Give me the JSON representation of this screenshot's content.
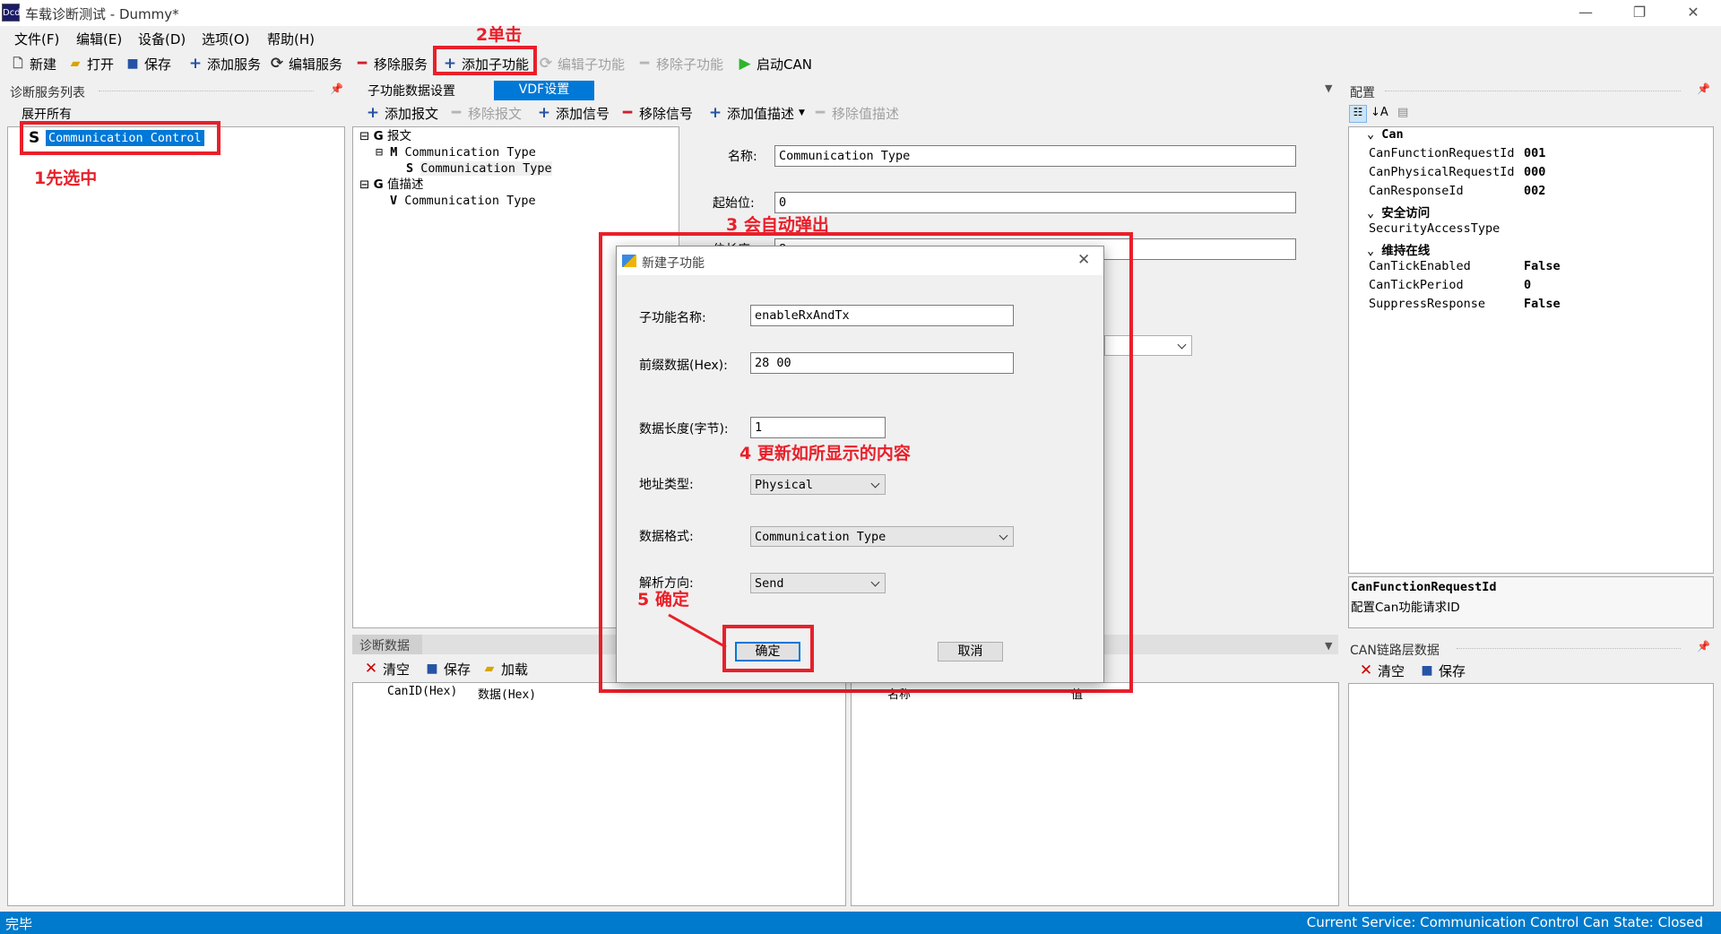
{
  "window": {
    "title": "车载诊断测试 - Dummy*",
    "app_icon_text": "Dcd"
  },
  "menu": [
    "文件(F)",
    "编辑(E)",
    "设备(D)",
    "选项(O)",
    "帮助(H)"
  ],
  "toolbar": {
    "new": "新建",
    "open": "打开",
    "save": "保存",
    "add_service": "添加服务",
    "edit_service": "编辑服务",
    "remove_service": "移除服务",
    "add_subfunction": "添加子功能",
    "edit_subfunction": "编辑子功能",
    "remove_subfunction": "移除子功能",
    "start_can": "启动CAN"
  },
  "left_panel": {
    "title": "诊断服务列表",
    "expand_all": "展开所有",
    "service_badge": "S",
    "selected_service": "Communication Control"
  },
  "annotations": {
    "a1": "1先选中",
    "a2": "2单击",
    "a3": "3 会自动弹出",
    "a4": "4 更新如所显示的内容",
    "a5": "5 确定"
  },
  "center": {
    "tabs": [
      "子功能数据设置",
      "VDF设置"
    ],
    "subtoolbar": {
      "add_message": "添加报文",
      "remove_message": "移除报文",
      "add_signal": "添加信号",
      "remove_signal": "移除信号",
      "add_value_desc": "添加值描述",
      "remove_value_desc": "移除值描述"
    },
    "tree": [
      {
        "badge": "G",
        "label": "报文"
      },
      {
        "badge": "M",
        "label": "Communication Type"
      },
      {
        "badge": "S",
        "label": "Communication Type"
      },
      {
        "badge": "G",
        "label": "值描述"
      },
      {
        "badge": "V",
        "label": "Communication Type"
      }
    ],
    "form": {
      "name_label": "名称:",
      "name_value": "Communication Type",
      "start_label": "起始位:",
      "start_value": "0",
      "len_label": "位长度:",
      "len_value": "8"
    }
  },
  "dialog": {
    "title": "新建子功能",
    "fields": {
      "subfunction_name_label": "子功能名称:",
      "subfunction_name": "enableRxAndTx",
      "prefix_label": "前缀数据(Hex):",
      "prefix": "28 00",
      "length_label": "数据长度(字节):",
      "length": "1",
      "address_label": "地址类型:",
      "address": "Physical",
      "format_label": "数据格式:",
      "format": "Communication Type",
      "direction_label": "解析方向:",
      "direction": "Send"
    },
    "ok": "确定",
    "cancel": "取消"
  },
  "diag_panel": {
    "title": "诊断数据",
    "clear": "清空",
    "save": "保存",
    "load": "加载",
    "col_canid": "CanID(Hex)",
    "col_data": "数据(Hex)",
    "col_name": "名称",
    "col_value": "值"
  },
  "config": {
    "title": "配置",
    "groups": [
      {
        "name": "Can",
        "rows": [
          [
            "CanFunctionRequestId",
            "001"
          ],
          [
            "CanPhysicalRequestId",
            "000"
          ],
          [
            "CanResponseId",
            "002"
          ]
        ]
      },
      {
        "name": "安全访问",
        "rows": [
          [
            "SecurityAccessType",
            ""
          ]
        ]
      },
      {
        "name": "维持在线",
        "rows": [
          [
            "CanTickEnabled",
            "False"
          ],
          [
            "CanTickPeriod",
            "0"
          ],
          [
            "SuppressResponse",
            "False"
          ]
        ]
      }
    ],
    "desc_title": "CanFunctionRequestId",
    "desc_text": "配置Can功能请求ID"
  },
  "can_panel": {
    "title": "CAN链路层数据",
    "clear": "清空",
    "save": "保存"
  },
  "status": {
    "left": "完毕",
    "right": "Current Service: Communication Control  Can State: Closed"
  },
  "colors": {
    "accent": "#0078d7",
    "annotation": "#e8202a",
    "statusbar": "#007acc"
  }
}
